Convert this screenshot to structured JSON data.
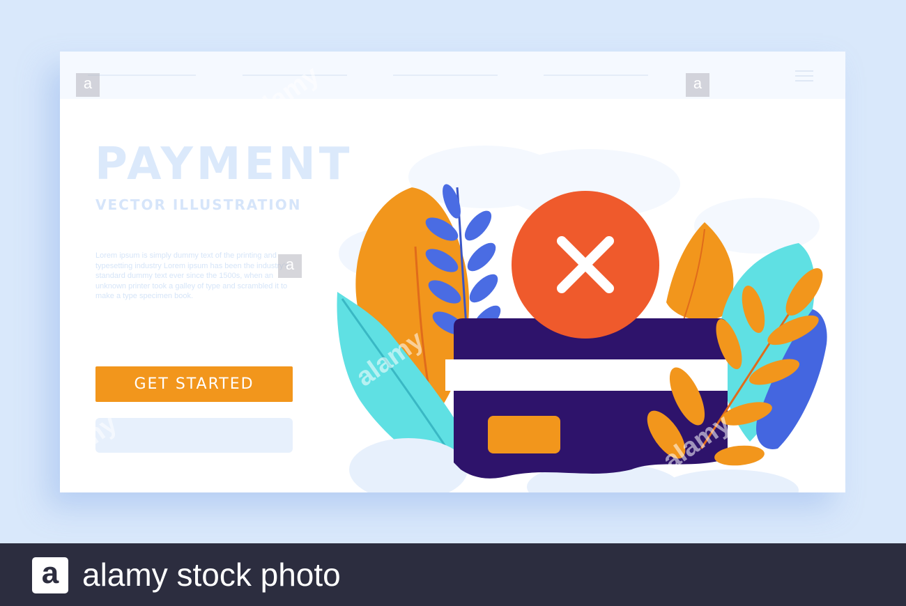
{
  "hero": {
    "title": "PAYMENT",
    "subtitle": "VECTOR ILLUSTRATION",
    "body": "Lorem ipsum is simply dummy text of the printing and typesetting industry Lorem ipsum has been the industry's standard dummy text ever since the 1500s, when an unknown printer took a galley of type and scrambled it to make a type specimen book.",
    "cta_label": "GET STARTED"
  },
  "illustration": {
    "status_icon": "close-icon",
    "card_icon": "credit-card-icon"
  },
  "watermark": {
    "text": "alamy",
    "box_letter": "a"
  },
  "footer": {
    "logo_letter": "a",
    "text": "alamy stock photo"
  },
  "colors": {
    "background": "#d9e8fb",
    "cta": "#f2961c",
    "error": "#ef5a2c",
    "card": "#2e136b",
    "teal": "#5fe0e3",
    "blue": "#4466e0",
    "orange": "#f2961c"
  }
}
